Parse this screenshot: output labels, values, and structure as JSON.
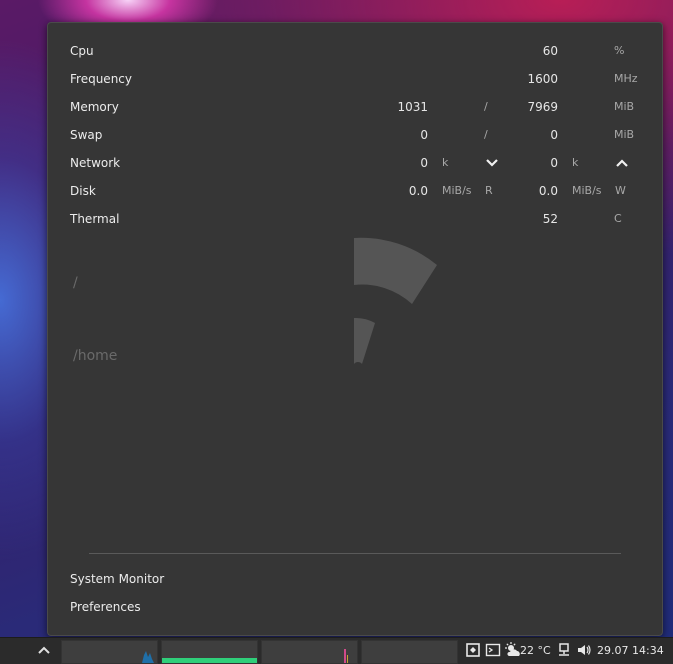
{
  "monitor": {
    "cpu": {
      "label": "Cpu",
      "value": "60",
      "unit": "%"
    },
    "frequency": {
      "label": "Frequency",
      "value": "1600",
      "unit": "MHz"
    },
    "memory": {
      "label": "Memory",
      "used": "1031",
      "sep": "/",
      "total": "7969",
      "unit": "MiB"
    },
    "swap": {
      "label": "Swap",
      "used": "0",
      "sep": "/",
      "total": "0",
      "unit": "MiB"
    },
    "network": {
      "label": "Network",
      "down": "0",
      "down_unit": "k",
      "down_icon": "chevron-down-icon",
      "up": "0",
      "up_unit": "k",
      "up_icon": "chevron-up-icon"
    },
    "disk": {
      "label": "Disk",
      "read": "0.0",
      "read_unit": "MiB/s",
      "read_tag": "R",
      "write": "0.0",
      "write_unit": "MiB/s",
      "write_tag": "W"
    },
    "thermal": {
      "label": "Thermal",
      "value": "52",
      "unit": "C"
    }
  },
  "disk_usage": [
    {
      "mount": "/"
    },
    {
      "mount": "/home"
    }
  ],
  "menu": {
    "system_monitor": "System Monitor",
    "preferences": "Preferences"
  },
  "taskbar": {
    "weather": "22 °C",
    "clock": "29.07 14:34"
  },
  "colors": {
    "popup_bg": "#363636",
    "gauge": "#555555",
    "graph_cpu": "#1f6fa8",
    "graph_mem": "#2fcf7a",
    "graph_net": "#d04a8a"
  }
}
